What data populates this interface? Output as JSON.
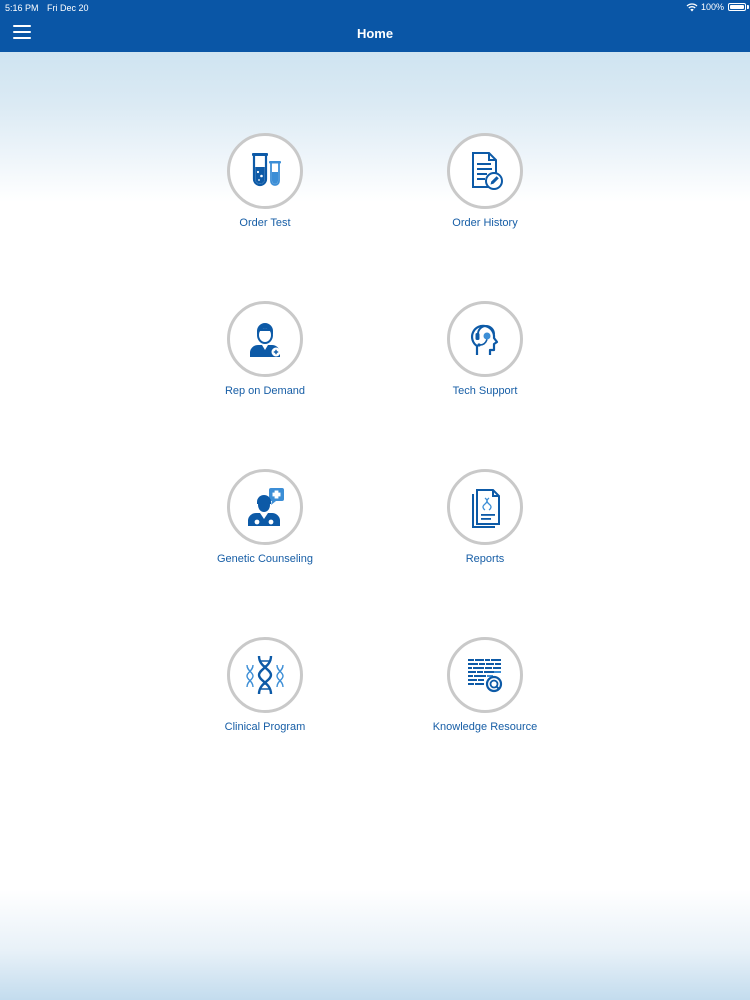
{
  "status_bar": {
    "time": "5:16 PM",
    "date": "Fri Dec 20",
    "battery": "100%"
  },
  "header": {
    "title": "Home",
    "menu_icon": "hamburger-icon"
  },
  "colors": {
    "header": "#0a56a6",
    "icon": "#0d5aa7",
    "accent": "#3c8ed6",
    "ring": "#c9c9c9",
    "label": "#175ea6"
  },
  "tiles": [
    {
      "label": "Order Test",
      "icon": "test-tubes-icon"
    },
    {
      "label": "Order History",
      "icon": "document-edit-icon"
    },
    {
      "label": "Rep on Demand",
      "icon": "representative-icon"
    },
    {
      "label": "Tech Support",
      "icon": "headset-support-icon"
    },
    {
      "label": "Genetic Counseling",
      "icon": "doctor-consult-icon"
    },
    {
      "label": "Reports",
      "icon": "report-document-icon"
    },
    {
      "label": "Clinical Program",
      "icon": "dna-icon"
    },
    {
      "label": "Knowledge Resource",
      "icon": "data-search-icon"
    }
  ]
}
